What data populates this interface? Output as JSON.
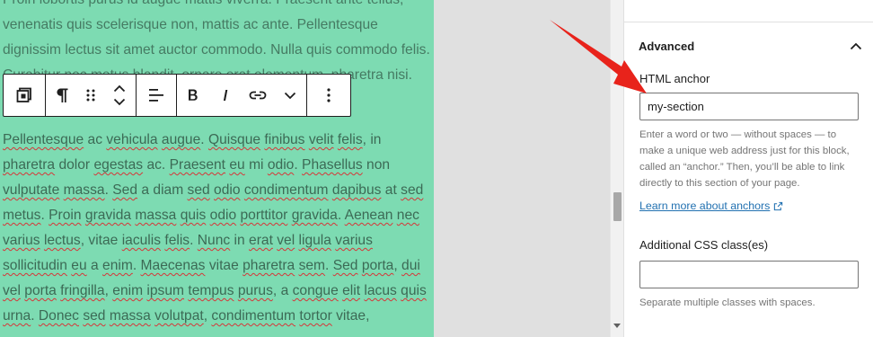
{
  "editor": {
    "top_paragraph": "Proin lobortis purus id augue mattis viverra. Praesent ante tellus, venenatis quis scelerisque non, mattis ac ante. Pellentesque dignissim lectus sit amet auctor commodo. Nulla quis commodo felis. Curabitur nec metus blandit, ornare erat elementum, pharetra nisi.",
    "paragraph_words": "Pellentesque ac vehicula augue. Quisque finibus velit felis, in pharetra dolor egestas ac. Praesent eu mi odio. Phasellus non vulputate massa. Sed a diam sed odio condimentum dapibus at sed metus. Proin gravida massa quis odio porttitor gravida. Aenean nec varius lectus, vitae iaculis felis. Nunc in erat vel ligula varius sollicitudin eu a enim. Maecenas vitae pharetra sem. Sed porta, dui vel porta fringilla, enim ipsum tempus purus, a congue elit lacus quis urna. Donec sed massa volutpat, condimentum tortor vitae,",
    "misspelled": [
      "Pellentesque",
      "vehicula",
      "augue",
      "Quisque",
      "finibus",
      "velit",
      "felis",
      "pharetra",
      "egestas",
      "Praesent",
      "eu",
      "odio",
      "Phasellus",
      "vulputate",
      "massa",
      "Sed",
      "sed",
      "odio",
      "condimentum",
      "dapibus",
      "metus",
      "Proin",
      "gravida",
      "massa",
      "quis",
      "odio",
      "porttitor",
      "gravida",
      "Aenean",
      "nec",
      "varius",
      "lectus",
      "iaculis",
      "felis",
      "Nunc",
      "erat",
      "vel",
      "ligula",
      "varius",
      "sollicitudin",
      "eu",
      "enim",
      "Maecenas",
      "pharetra",
      "sem",
      "Sed",
      "porta",
      "dui",
      "vel",
      "porta",
      "fringilla",
      "enim",
      "ipsum",
      "tempus",
      "purus",
      "congue",
      "elit",
      "lacus",
      "quis",
      "urna",
      "Donec",
      "sed",
      "massa",
      "volutpat",
      "condimentum",
      "tortor"
    ]
  },
  "toolbar": {
    "icons": [
      "duplicate-block-icon",
      "paragraph-icon",
      "drag-handle-icon",
      "move-up-down-icon",
      "align-left-icon",
      "bold-icon",
      "italic-icon",
      "link-icon",
      "more-rich-text-icon",
      "options-icon"
    ]
  },
  "sidebar": {
    "section_title": "Advanced",
    "html_anchor_label": "HTML anchor",
    "html_anchor_value": "my-section",
    "html_anchor_help": "Enter a word or two — without spaces — to make a unique web address just for this block, called an “anchor.” Then, you’ll be able to link directly to this section of your page.",
    "learn_more_link": "Learn more about anchors",
    "css_class_label": "Additional CSS class(es)",
    "css_class_value": "",
    "css_class_help": "Separate multiple classes with spaces."
  },
  "colors": {
    "block_background": "#7ddbb2",
    "canvas_background": "#e0e0e0",
    "link": "#2271b1",
    "annotation_arrow": "#e8231b",
    "spellcheck": "#d63638"
  }
}
